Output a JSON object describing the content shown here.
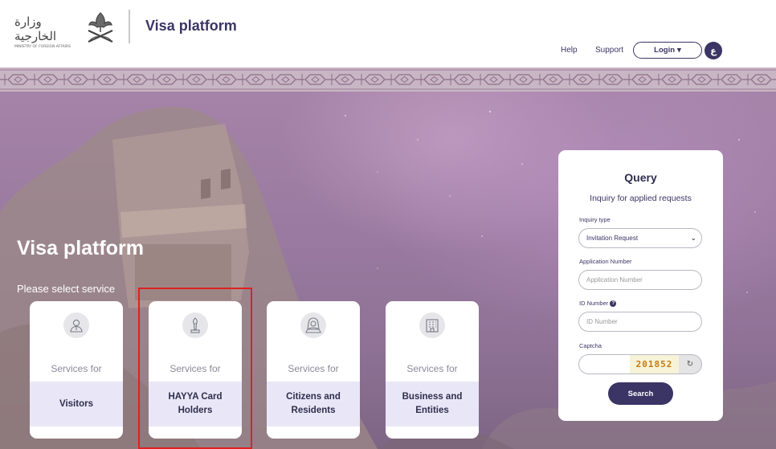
{
  "header": {
    "logo_arabic": "وزارة الخارجية",
    "logo_english": "MINISTRY OF FOREIGN AFFAIRS",
    "title": "Visa platform",
    "nav": {
      "help": "Help",
      "support": "Support",
      "login": "Login",
      "login_caret": "▾",
      "lang": "ع"
    }
  },
  "hero": {
    "title": "Visa platform",
    "prompt": "Please select service",
    "cards": [
      {
        "prefix": "Services for",
        "label": "Visitors",
        "icon": "visitor-icon"
      },
      {
        "prefix": "Services for",
        "label": "HAYYA Card Holders",
        "icon": "torch-trophy-icon"
      },
      {
        "prefix": "Services for",
        "label": "Citizens and Residents",
        "icon": "citizen-icon"
      },
      {
        "prefix": "Services for",
        "label": "Business and Entities",
        "icon": "building-icon"
      }
    ]
  },
  "query": {
    "title": "Query",
    "subtitle": "Inquiry for applied requests",
    "inquiry_type_label": "Inquiry type",
    "inquiry_type_value": "Invitation Request",
    "application_number_label": "Application Number",
    "application_number_placeholder": "Application Number",
    "id_number_label": "ID Number",
    "id_number_placeholder": "ID Number",
    "captcha_label": "Captcha",
    "captcha_text": "201852",
    "search_button": "Search"
  },
  "colors": {
    "brand": "#3b3565",
    "card_label_bg": "#e9e6f7",
    "highlight": "#e02020"
  }
}
